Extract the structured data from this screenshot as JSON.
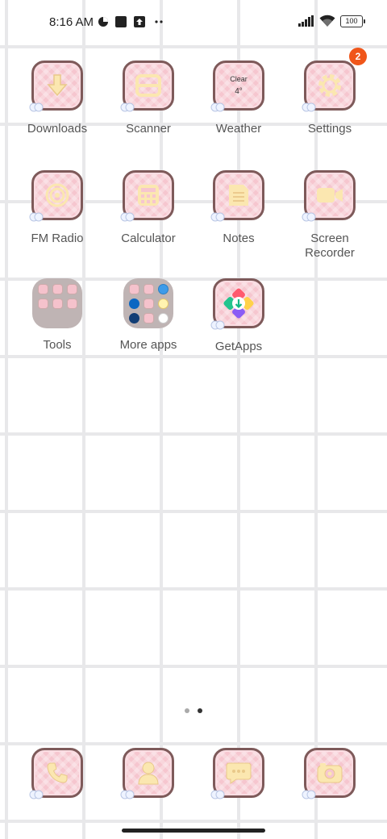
{
  "status_bar": {
    "time": "8:16 AM",
    "battery": "100",
    "icons": [
      "data-saver-icon",
      "square-notification-icon",
      "upload-notification-icon",
      "more-notifications-icon",
      "signal-icon",
      "wifi-icon",
      "battery-icon"
    ]
  },
  "apps": [
    {
      "label": "Downloads",
      "icon": "download-icon"
    },
    {
      "label": "Scanner",
      "icon": "scanner-icon"
    },
    {
      "label": "Weather",
      "icon": "weather-icon",
      "condition": "Clear",
      "temp": "4°"
    },
    {
      "label": "Settings",
      "icon": "gear-icon",
      "badge": "2"
    },
    {
      "label": "FM Radio",
      "icon": "radio-icon"
    },
    {
      "label": "Calculator",
      "icon": "calculator-icon"
    },
    {
      "label": "Notes",
      "icon": "notes-icon"
    },
    {
      "label": "Screen Recorder",
      "icon": "video-camera-icon"
    },
    {
      "label": "Tools",
      "icon": "folder-icon"
    },
    {
      "label": "More apps",
      "icon": "folder-icon"
    },
    {
      "label": "GetApps",
      "icon": "getapps-icon"
    }
  ],
  "dock": [
    {
      "icon": "phone-icon"
    },
    {
      "icon": "contacts-icon"
    },
    {
      "icon": "messages-icon"
    },
    {
      "icon": "camera-icon"
    }
  ],
  "page_indicator": {
    "pages": 2,
    "current": 2
  },
  "colors": {
    "tile": "#f6c6cf",
    "tile_border": "#7e5a5a",
    "glyph": "#fbe7b0",
    "badge": "#f0561a"
  }
}
